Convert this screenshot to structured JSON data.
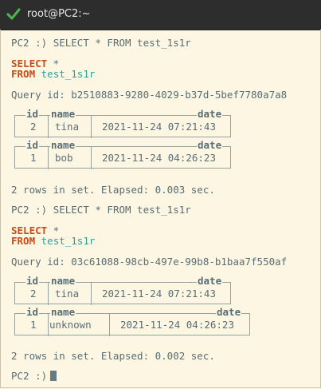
{
  "window": {
    "title": "root@PC2:~"
  },
  "prompt": "PC2 :)",
  "queries": [
    {
      "command": "SELECT * FROM test_1s1r",
      "select_kw": "SELECT",
      "select_rest": " *",
      "from_kw": "FROM",
      "table": "test_1s1r",
      "query_id": "Query id: b2510883-9280-4029-b37d-5bef7780a7a8",
      "results": [
        {
          "headers": [
            "id",
            "name",
            "date"
          ],
          "row": [
            "2",
            "tina",
            "2021-11-24 07:21:43"
          ]
        },
        {
          "headers": [
            "id",
            "name",
            "date"
          ],
          "row": [
            "1",
            "bob",
            "2021-11-24 04:26:23"
          ]
        }
      ],
      "summary": "2 rows in set. Elapsed: 0.003 sec."
    },
    {
      "command": "SELECT * FROM test_1s1r",
      "select_kw": "SELECT",
      "select_rest": " *",
      "from_kw": "FROM",
      "table": "test_1s1r",
      "query_id": "Query id: 03c61088-98cb-497e-99b8-b1baa7f550af",
      "results": [
        {
          "headers": [
            "id",
            "name",
            "date"
          ],
          "row": [
            "2",
            "tina",
            "2021-11-24 07:21:43"
          ]
        },
        {
          "headers": [
            "id",
            "name",
            "date"
          ],
          "row": [
            "1",
            "unknown",
            "2021-11-24 04:26:23"
          ]
        }
      ],
      "summary": "2 rows in set. Elapsed: 0.002 sec."
    }
  ],
  "icons": {
    "title_icon": "check-icon"
  },
  "colors": {
    "background": "#fdf6e3",
    "keyword": "#cb4b16",
    "table_name": "#2aa198",
    "check": "#4caf50"
  }
}
